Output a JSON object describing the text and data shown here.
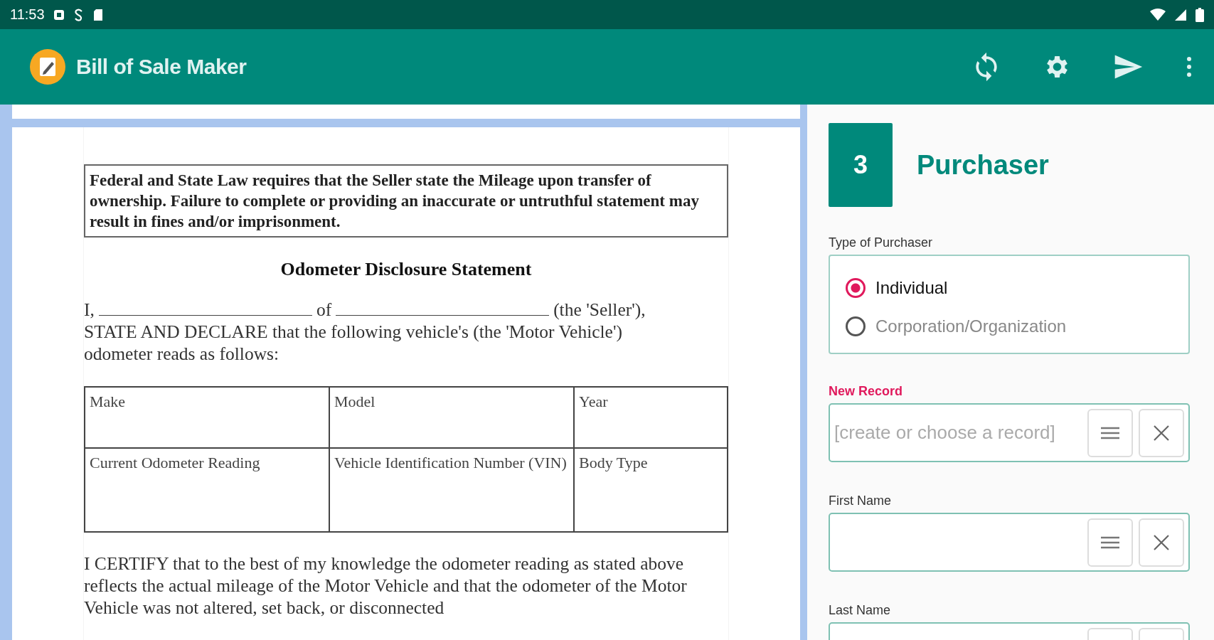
{
  "status_bar": {
    "time": "11:53"
  },
  "app_bar": {
    "title": "Bill of Sale Maker"
  },
  "document": {
    "notice": "Federal and State Law requires that the Seller state the Mileage upon transfer of ownership. Failure to complete or providing an inaccurate or untruthful statement may result in fines and/or imprisonment.",
    "heading": "Odometer Disclosure Statement",
    "declaration_parts": [
      "I,",
      "of",
      "(the 'Seller'), STATE AND DECLARE that the following vehicle's (the 'Motor Vehicle') odometer reads as follows:"
    ],
    "table": {
      "rows": [
        [
          "Make",
          "Model",
          "Year"
        ],
        [
          "Current Odometer Reading",
          "Vehicle Identification Number (VIN)",
          "Body Type"
        ]
      ]
    },
    "certification": "I CERTIFY that to the best of my knowledge the odometer reading as stated above reflects the actual mileage of the Motor Vehicle and that the odometer of the Motor Vehicle was not altered, set back, or disconnected"
  },
  "form": {
    "step": "3",
    "title": "Purchaser",
    "purchaser_type": {
      "label": "Type of Purchaser",
      "options": [
        {
          "label": "Individual",
          "selected": true
        },
        {
          "label": "Corporation/Organization",
          "selected": false
        }
      ]
    },
    "fields": [
      {
        "label": "New Record",
        "placeholder": "[create or choose a record]",
        "focused": true
      },
      {
        "label": "First Name",
        "focused": false
      },
      {
        "label": "Last Name",
        "focused": false
      }
    ]
  }
}
